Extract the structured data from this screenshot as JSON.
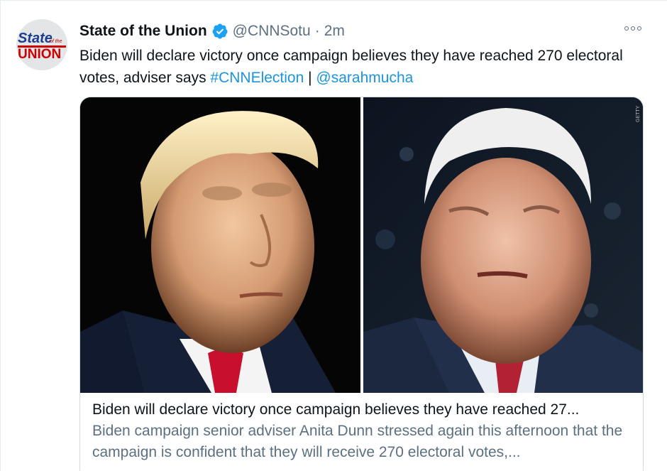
{
  "tweet": {
    "display_name": "State of the Union",
    "handle": "@CNNSotu",
    "separator": "·",
    "time": "2m",
    "verified": true,
    "text_main": "Biden will declare victory once campaign believes they have reached 270 electoral votes, adviser says ",
    "hashtag": "#CNNElection",
    "divider": " | ",
    "mention": "@sarahmucha",
    "avatar": {
      "logo_line1": "State",
      "logo_small": "of the",
      "logo_line2": "UNION"
    },
    "more_icon": "more-horizontal-icon"
  },
  "card": {
    "title": "Biden will declare victory once campaign believes they have reached 27...",
    "description": "Biden campaign senior adviser Anita Dunn stressed again this afternoon that the campaign is confident that they will receive 270 electoral votes,...",
    "image_watermark": "GETTY"
  },
  "colors": {
    "text": "#0f1419",
    "secondary": "#5b7083",
    "link": "#1b95e0",
    "verified": "#1da1f2",
    "logo_blue": "#1a3d8f",
    "logo_red": "#cc0000"
  }
}
